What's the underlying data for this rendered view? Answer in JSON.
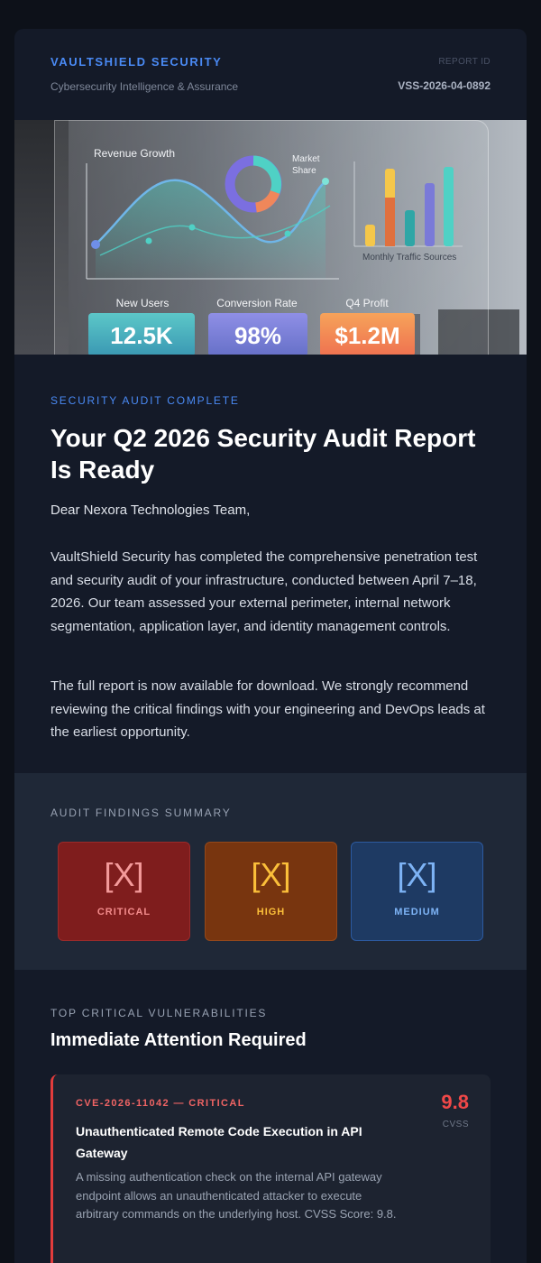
{
  "header": {
    "brand": "VAULTSHIELD SECURITY",
    "tagline": "Cybersecurity Intelligence & Assurance",
    "report_id_label": "REPORT ID",
    "report_id": "VSS-2026-04-0892"
  },
  "hero": {
    "chart1_title": "Revenue Growth",
    "chart2_title_line1": "Market",
    "chart2_title_line2": "Share",
    "chart3_title": "Monthly Traffic Sources",
    "kpis": [
      {
        "label": "New Users",
        "value": "12.5K"
      },
      {
        "label": "Conversion Rate",
        "value": "98%"
      },
      {
        "label": "Q4 Profit",
        "value": "$1.2M"
      }
    ]
  },
  "intro": {
    "eyebrow": "SECURITY AUDIT COMPLETE",
    "title": "Your Q2 2026 Security Audit Report Is Ready",
    "greeting": "Dear Nexora Technologies Team,",
    "paragraph1": "VaultShield Security has completed the comprehensive penetration test and security audit of your infrastructure, conducted between April 7–18, 2026. Our team assessed your external perimeter, internal network segmentation, application layer, and identity management controls.",
    "paragraph2": "The full report is now available for download. We strongly recommend reviewing the critical findings with your engineering and DevOps leads at the earliest opportunity."
  },
  "findings": {
    "label": "AUDIT FINDINGS SUMMARY",
    "tiles": [
      {
        "count": "[X]",
        "severity": "CRITICAL",
        "color": "#7f1d1d"
      },
      {
        "count": "[X]",
        "severity": "HIGH",
        "color": "#78350f"
      },
      {
        "count": "[X]",
        "severity": "MEDIUM",
        "color": "#1e3a63"
      }
    ]
  },
  "vulnerabilities": {
    "label": "TOP CRITICAL VULNERABILITIES",
    "heading": "Immediate Attention Required",
    "items": [
      {
        "id": "CVE-2026-11042 — CRITICAL",
        "title": "Unauthenticated Remote Code Execution in API Gateway",
        "description": "A missing authentication check on the internal API gateway endpoint allows an unauthenticated attacker to execute arbitrary commands on the underlying host. CVSS Score: 9.8.",
        "score": "9.8",
        "score_label": "CVSS"
      }
    ]
  }
}
